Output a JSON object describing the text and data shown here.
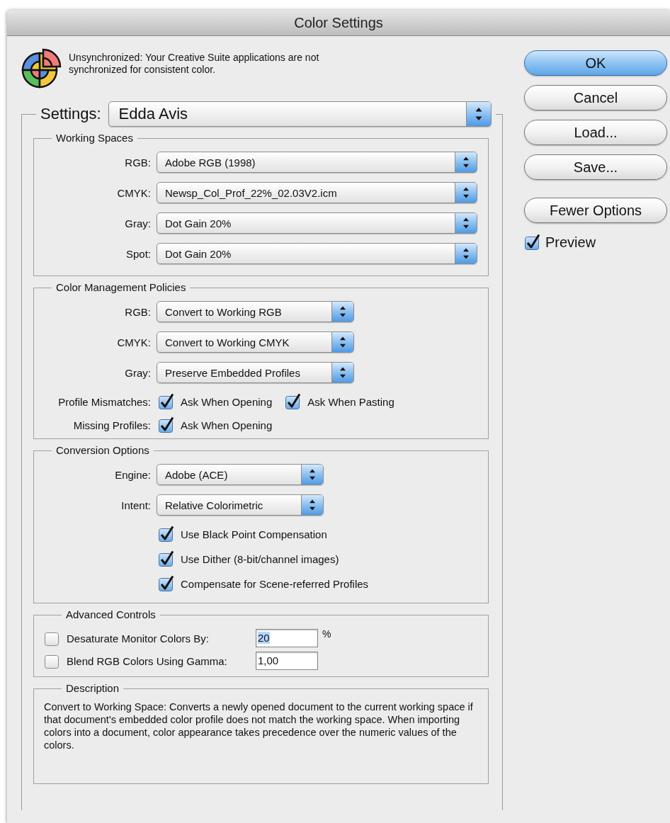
{
  "window": {
    "title": "Color Settings"
  },
  "sync_message": "Unsynchronized: Your Creative Suite applications are not synchronized for consistent color.",
  "settings": {
    "label": "Settings:",
    "value": "Edda Avis"
  },
  "sections": [
    {
      "kind": "working_spaces",
      "title": "Working Spaces",
      "rows": [
        {
          "kind": "popup",
          "label": "RGB:",
          "value": "Adobe RGB (1998)"
        },
        {
          "kind": "popup",
          "label": "CMYK:",
          "value": "Newsp_Col_Prof_22%_02.03V2.icm"
        },
        {
          "kind": "popup",
          "label": "Gray:",
          "value": "Dot Gain 20%"
        },
        {
          "kind": "popup",
          "label": "Spot:",
          "value": "Dot Gain 20%"
        }
      ]
    },
    {
      "kind": "policies",
      "title": "Color Management Policies",
      "rows": [
        {
          "kind": "popup",
          "label": "RGB:",
          "value": "Convert to Working RGB"
        },
        {
          "kind": "popup",
          "label": "CMYK:",
          "value": "Convert to Working CMYK"
        },
        {
          "kind": "popup",
          "label": "Gray:",
          "value": "Preserve Embedded Profiles"
        },
        {
          "kind": "checks",
          "label": "Profile Mismatches:",
          "checks": [
            {
              "label": "Ask When Opening",
              "checked": true
            },
            {
              "label": "Ask When Pasting",
              "checked": true
            }
          ]
        },
        {
          "kind": "checks",
          "label": "Missing Profiles:",
          "checks": [
            {
              "label": "Ask When Opening",
              "checked": true
            }
          ]
        }
      ]
    },
    {
      "kind": "conversion",
      "title": "Conversion Options",
      "rows": [
        {
          "kind": "popup",
          "label": "Engine:",
          "value": "Adobe (ACE)"
        },
        {
          "kind": "popup",
          "label": "Intent:",
          "value": "Relative Colorimetric"
        },
        {
          "kind": "checks",
          "checks": [
            {
              "label": "Use Black Point Compensation",
              "checked": true
            }
          ]
        },
        {
          "kind": "checks",
          "checks": [
            {
              "label": "Use Dither (8-bit/channel images)",
              "checked": true
            }
          ]
        },
        {
          "kind": "checks",
          "checks": [
            {
              "label": "Compensate for Scene-referred Profiles",
              "checked": true
            }
          ]
        }
      ]
    },
    {
      "kind": "advanced",
      "title": "Advanced Controls",
      "rows": [
        {
          "kind": "field",
          "label": "Desaturate Monitor Colors By:",
          "checked": false,
          "value": "20",
          "text_selected": true,
          "unit": "%"
        },
        {
          "kind": "field",
          "label": "Blend RGB Colors Using Gamma:",
          "checked": false,
          "value": "1,00",
          "text_selected": false
        }
      ]
    },
    {
      "kind": "description",
      "title": "Description",
      "rows": [
        {
          "kind": "text",
          "text": "Convert to Working Space:  Converts a newly opened document to the current working space if that document's embedded color profile does not match the working space.  When importing colors into a document, color appearance takes precedence over the numeric values of the colors."
        }
      ]
    }
  ],
  "buttons": [
    {
      "label": "OK",
      "default": true
    },
    {
      "label": "Cancel",
      "default": false
    },
    {
      "label": "Load...",
      "default": false
    },
    {
      "label": "Save...",
      "default": false
    }
  ],
  "options_button": {
    "label": "Fewer Options"
  },
  "preview": {
    "label": "Preview",
    "checked": true
  }
}
